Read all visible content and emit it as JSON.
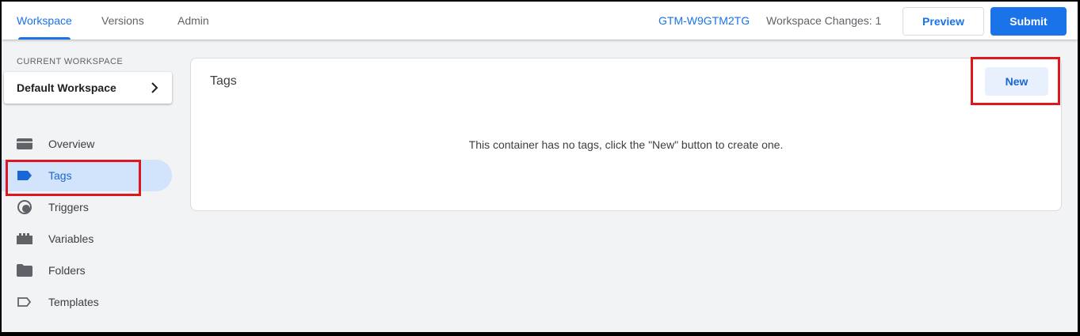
{
  "topbar": {
    "tabs": [
      {
        "label": "Workspace",
        "active": true
      },
      {
        "label": "Versions",
        "active": false
      },
      {
        "label": "Admin",
        "active": false
      }
    ],
    "container_id": "GTM-W9GTM2TG",
    "workspace_changes": "Workspace Changes: 1",
    "preview_label": "Preview",
    "submit_label": "Submit"
  },
  "sidebar": {
    "current_workspace_label": "CURRENT WORKSPACE",
    "workspace_name": "Default Workspace",
    "items": [
      {
        "label": "Overview",
        "icon": "overview-icon",
        "active": false
      },
      {
        "label": "Tags",
        "icon": "tag-icon",
        "active": true
      },
      {
        "label": "Triggers",
        "icon": "trigger-icon",
        "active": false
      },
      {
        "label": "Variables",
        "icon": "variables-icon",
        "active": false
      },
      {
        "label": "Folders",
        "icon": "folder-icon",
        "active": false
      },
      {
        "label": "Templates",
        "icon": "template-icon",
        "active": false
      }
    ]
  },
  "main": {
    "title": "Tags",
    "new_button_label": "New",
    "empty_message": "This container has no tags, click the \"New\" button to create one."
  },
  "colors": {
    "accent": "#1a73e8",
    "active_bg": "#d2e3fc",
    "highlight": "#e0161e",
    "background": "#f1f3f4"
  }
}
